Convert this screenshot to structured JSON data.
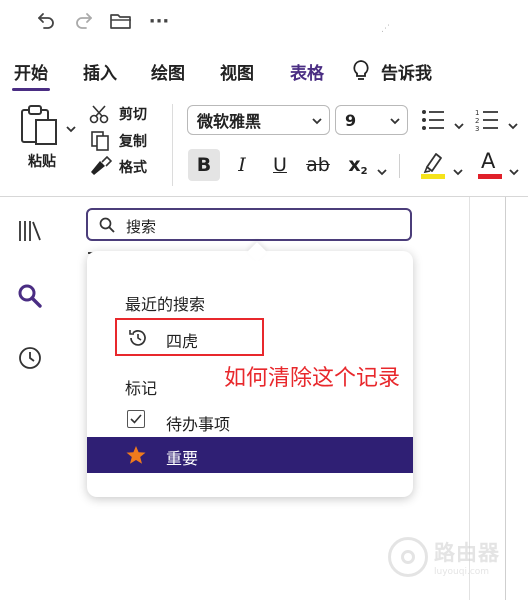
{
  "quick_access": {
    "more_label": "···"
  },
  "tabs": [
    {
      "label": "开始",
      "active": true
    },
    {
      "label": "插入"
    },
    {
      "label": "绘图"
    },
    {
      "label": "视图"
    },
    {
      "label": "表格"
    },
    {
      "label": "告诉我"
    }
  ],
  "ribbon": {
    "paste_label": "粘贴",
    "cut_label": "剪切",
    "copy_label": "复制",
    "format_painter_label": "格式",
    "font_name": "微软雅黑",
    "font_size": "9",
    "bold_label": "B",
    "italic_label": "I",
    "underline_label": "U",
    "strike_label": "ab",
    "subscript_label": "x",
    "subscript_sub": "2",
    "font_color_label": "A",
    "highlight_color": "#f5e31a",
    "font_color": "#e0202a"
  },
  "search": {
    "placeholder": "搜索"
  },
  "dropdown": {
    "recent_heading": "最近的搜索",
    "recent_items": [
      {
        "label": "四虎",
        "icon": "history-icon"
      }
    ],
    "tags_heading": "标记",
    "tag_items": [
      {
        "label": "待办事项",
        "icon": "checkbox-icon"
      },
      {
        "label": "重要",
        "icon": "star-icon",
        "highlighted": true
      }
    ]
  },
  "annotation": {
    "text": "如何清除这个记录",
    "color": "#e8282c"
  },
  "watermark": {
    "cn": "路由器",
    "en": "luyouqi.com"
  },
  "colors": {
    "accent": "#4a2d83",
    "highlight_row": "#2f1f74",
    "star": "#f07a1c"
  }
}
